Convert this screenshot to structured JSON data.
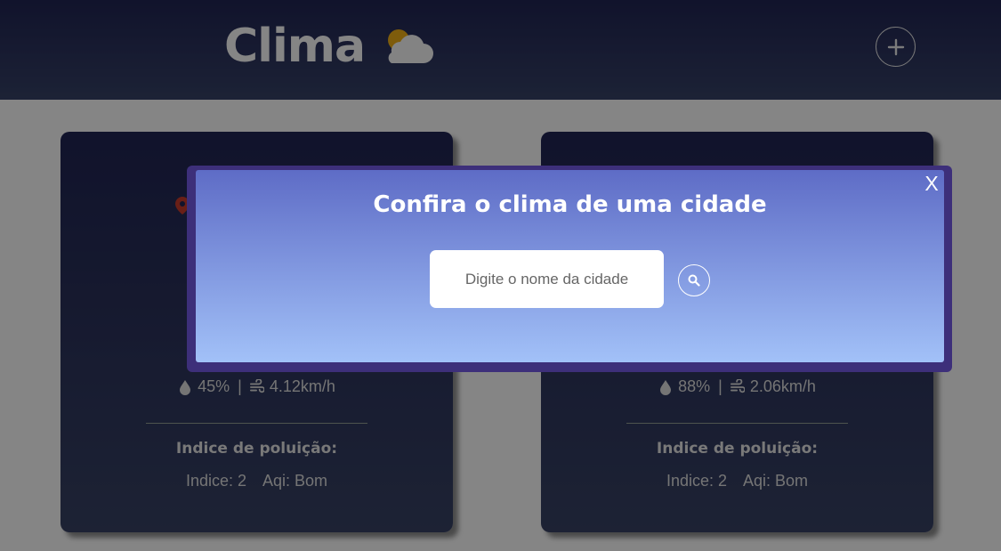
{
  "header": {
    "title": "Clima",
    "logo_icon": "cloud-sun-icon",
    "add_icon": "plus-icon"
  },
  "cards": [
    {
      "humidity": "45%",
      "separator": "|",
      "wind": "4.12km/h",
      "pollution_title": "Indice de poluição:",
      "index": "Indice: 2",
      "aqi": "Aqi: Bom"
    },
    {
      "humidity": "88%",
      "separator": "|",
      "wind": "2.06km/h",
      "pollution_title": "Indice de poluição:",
      "index": "Indice: 2",
      "aqi": "Aqi: Bom"
    }
  ],
  "modal": {
    "title": "Confira o clima de uma cidade",
    "close_label": "X",
    "search_placeholder": "Digite o nome da cidade",
    "search_icon": "search-icon"
  },
  "colors": {
    "header_top": "#1f2350",
    "header_bottom": "#343f63",
    "modal_top": "#5e6cc6",
    "modal_bottom": "#a2c1f8",
    "pin": "#c0392b"
  }
}
